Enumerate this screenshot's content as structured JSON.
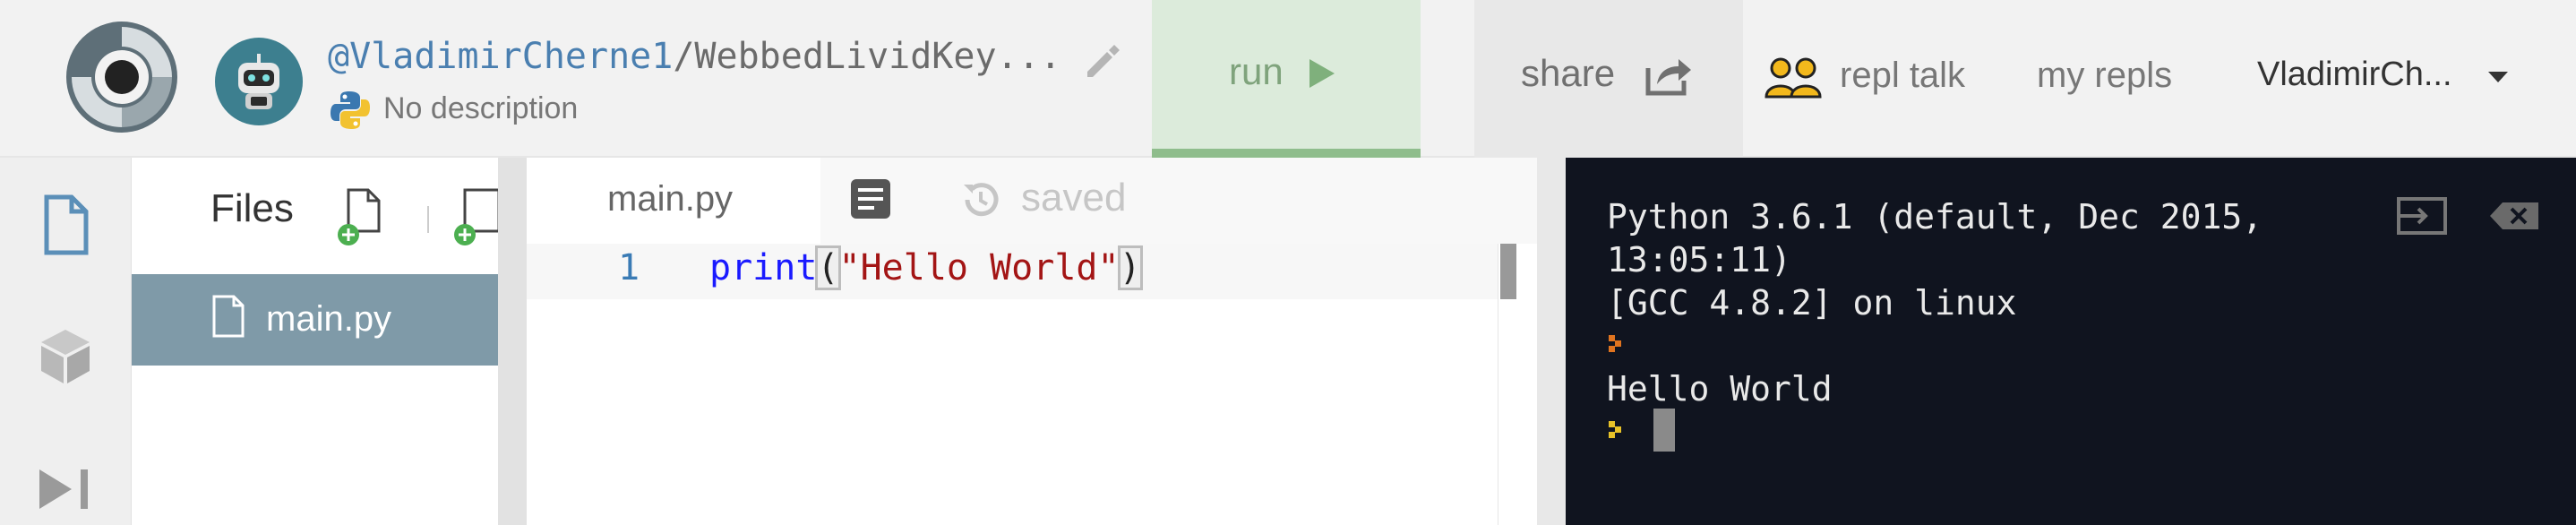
{
  "header": {
    "repl_user": "@VladimirCherne1",
    "repl_sep": "/",
    "repl_name": "WebbedLividKey...",
    "description": "No description",
    "run_label": "run",
    "share_label": "share",
    "nav": [
      "repl talk",
      "my repls"
    ],
    "user_menu": "VladimirCh..."
  },
  "files": {
    "title": "Files",
    "items": [
      {
        "name": "main.py"
      }
    ]
  },
  "editor": {
    "tab_label": "main.py",
    "status": "saved",
    "line_number": "1",
    "code": {
      "fn": "print",
      "open": "(",
      "str": "\"Hello World\"",
      "close": ")"
    }
  },
  "console": {
    "lines": "Python 3.6.1 (default, Dec 2015,\n13:05:11)\n[GCC 4.8.2] on linux\n\nHello World\n"
  },
  "colors": {
    "run_bg": "#dcebdb",
    "console_bg": "#10141f",
    "file_selected": "#7f9aa8"
  }
}
